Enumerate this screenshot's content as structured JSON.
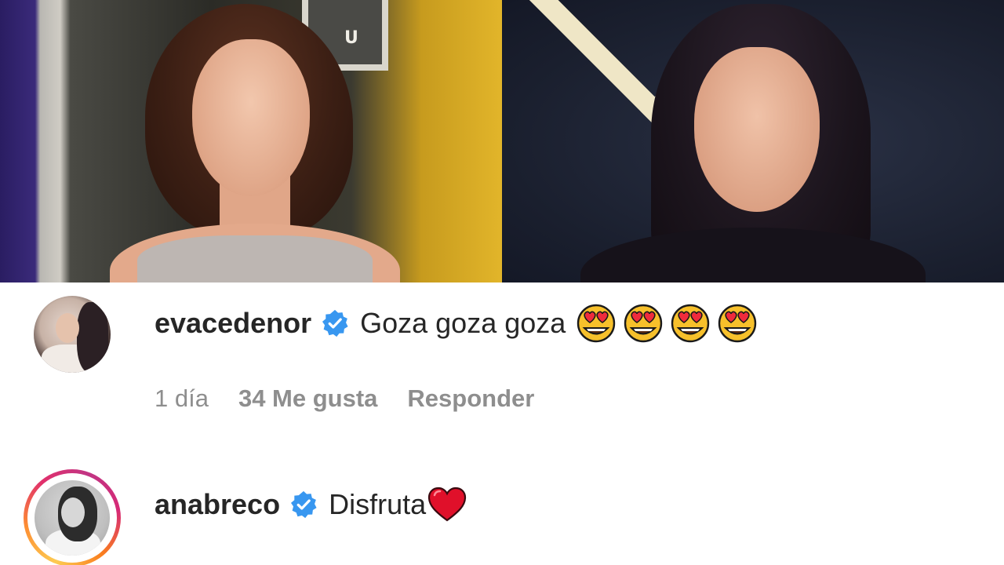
{
  "banner": {
    "left_photo_sign": "U"
  },
  "comments": [
    {
      "username": "evacedenor",
      "verified": true,
      "text": "Goza goza goza",
      "emoji": [
        "heart-eyes-emoji",
        "heart-eyes-emoji",
        "heart-eyes-emoji",
        "heart-eyes-emoji"
      ],
      "time": "1 día",
      "likes": "34 Me gusta",
      "reply_label": "Responder"
    },
    {
      "username": "anabreco",
      "verified": true,
      "text": "Disfruta",
      "emoji": [
        "red-heart-emoji"
      ],
      "story_ring": true
    }
  ],
  "colors": {
    "text_primary": "#262626",
    "text_secondary": "#8e8e8e",
    "verified_blue": "#3897f0",
    "heart_red": "#e0102a"
  }
}
